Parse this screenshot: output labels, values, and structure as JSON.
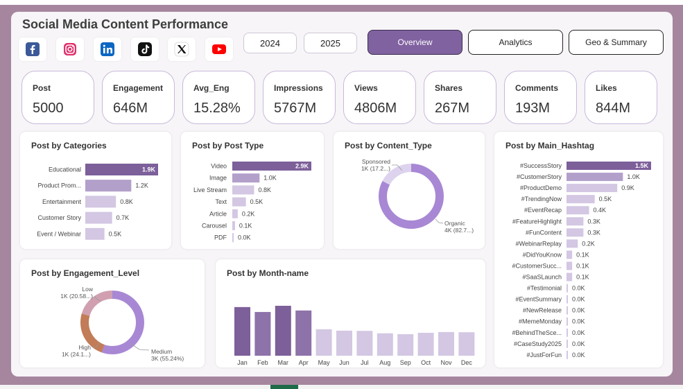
{
  "title": "Social Media Content Performance",
  "socials": [
    {
      "icon": "facebook-icon",
      "color": "#1877f2"
    },
    {
      "icon": "instagram-icon",
      "color": "#e1306c"
    },
    {
      "icon": "linkedin-icon",
      "color": "#0a66c2"
    },
    {
      "icon": "tiktok-icon",
      "color": "#000000"
    },
    {
      "icon": "x-icon",
      "color": "#000000"
    },
    {
      "icon": "youtube-icon",
      "color": "#ff0000"
    }
  ],
  "years": [
    "2024",
    "2025"
  ],
  "nav": {
    "overview": "Overview",
    "analytics": "Analytics",
    "geo": "Geo & Summary"
  },
  "kpis": [
    {
      "label": "Post",
      "value": "5000"
    },
    {
      "label": "Engagement",
      "value": "646M"
    },
    {
      "label": "Avg_Eng",
      "value": "15.28%"
    },
    {
      "label": "Impressions",
      "value": "5767M"
    },
    {
      "label": "Views",
      "value": "4806M"
    },
    {
      "label": "Shares",
      "value": "267M"
    },
    {
      "label": "Comments",
      "value": "193M"
    },
    {
      "label": "Likes",
      "value": "844M"
    }
  ],
  "colors": {
    "accent": "#8062a0",
    "bar_dark": "#7d5f9a",
    "bar_mid": "#b2a0cb",
    "bar_light": "#d3c7e3",
    "donut_purple": "#a888d4",
    "donut_light": "#ddd3ee",
    "donut_orange": "#c27c58",
    "donut_pink": "#d0a0b0"
  },
  "chart_data": [
    {
      "type": "bar",
      "title": "Post by Categories",
      "orientation": "horizontal",
      "categories": [
        "Educational",
        "Product Prom...",
        "Entertainment",
        "Customer Story",
        "Event / Webinar"
      ],
      "values": [
        1900,
        1200,
        800,
        700,
        500
      ],
      "labels": [
        "1.9K",
        "1.2K",
        "0.8K",
        "0.7K",
        "0.5K"
      ]
    },
    {
      "type": "bar",
      "title": "Post by Post Type",
      "orientation": "horizontal",
      "categories": [
        "Video",
        "Image",
        "Live Stream",
        "Text",
        "Article",
        "Carousel",
        "PDF"
      ],
      "values": [
        2900,
        1000,
        800,
        500,
        200,
        100,
        0
      ],
      "labels": [
        "2.9K",
        "1.0K",
        "0.8K",
        "0.5K",
        "0.2K",
        "0.1K",
        "0.0K"
      ]
    },
    {
      "type": "pie",
      "title": "Post by Content_Type",
      "donut": true,
      "slices": [
        {
          "name": "Organic",
          "value": 82.7,
          "label": "4K (82.7...)"
        },
        {
          "name": "Sponsored",
          "value": 17.3,
          "label": "1K (17.2...)"
        }
      ]
    },
    {
      "type": "bar",
      "title": "Post by Main_Hashtag",
      "orientation": "horizontal",
      "categories": [
        "#SuccessStory",
        "#CustomerStory",
        "#ProductDemo",
        "#TrendingNow",
        "#EventRecap",
        "#FeatureHighlight",
        "#FunContent",
        "#WebinarReplay",
        "#DidYouKnow",
        "#CustomerSucc...",
        "#SaaSLaunch",
        "#Testimonial",
        "#EventSummary",
        "#NewRelease",
        "#MemeMonday",
        "#BehindTheSce...",
        "#CaseStudy2025",
        "#JustForFun"
      ],
      "values": [
        1500,
        1000,
        900,
        500,
        400,
        300,
        300,
        200,
        100,
        100,
        100,
        0,
        0,
        0,
        0,
        0,
        0,
        0
      ],
      "labels": [
        "1.5K",
        "1.0K",
        "0.9K",
        "0.5K",
        "0.4K",
        "0.3K",
        "0.3K",
        "0.2K",
        "0.1K",
        "0.1K",
        "0.1K",
        "0.0K",
        "0.0K",
        "0.0K",
        "0.0K",
        "0.0K",
        "0.0K",
        "0.0K"
      ]
    },
    {
      "type": "pie",
      "title": "Post by Engagement_Level",
      "donut": true,
      "slices": [
        {
          "name": "Medium",
          "value": 55.24,
          "label": "3K (55.24%)"
        },
        {
          "name": "High",
          "value": 24.1,
          "label": "1K (24.1...)"
        },
        {
          "name": "Low",
          "value": 20.58,
          "label": "1K (20.58...)"
        }
      ]
    },
    {
      "type": "bar",
      "title": "Post by Month-name",
      "categories": [
        "Jan",
        "Feb",
        "Mar",
        "Apr",
        "May",
        "Jun",
        "Jul",
        "Aug",
        "Sep",
        "Oct",
        "Nov",
        "Dec"
      ],
      "values": [
        456,
        410,
        468,
        424,
        248,
        235,
        233,
        210,
        202,
        215,
        222,
        220
      ]
    }
  ]
}
